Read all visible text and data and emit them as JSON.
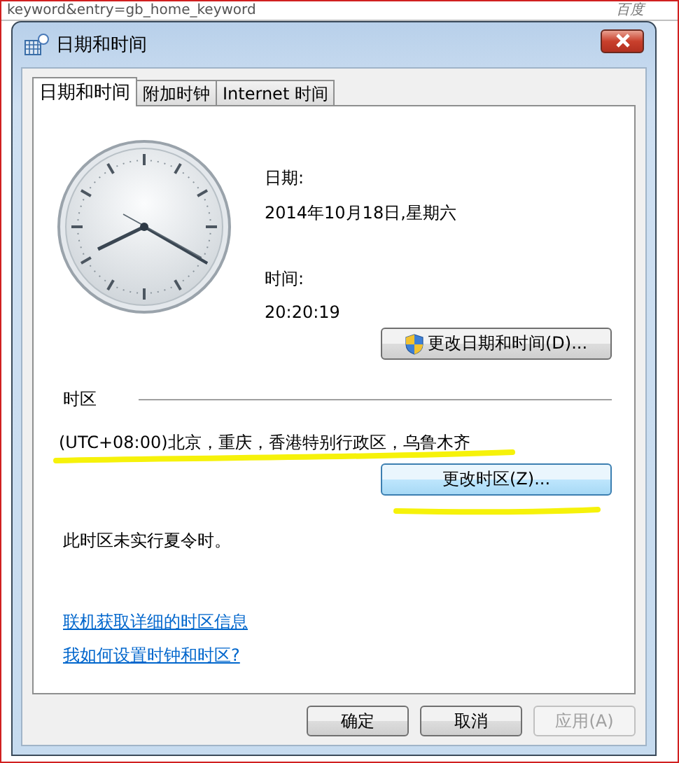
{
  "browser": {
    "address_text": "keyword&entry=gb_home_keyword",
    "search_label": "百度"
  },
  "window": {
    "title": "日期和时间"
  },
  "tabs": [
    {
      "label": "日期和时间",
      "selected": true
    },
    {
      "label": "附加时钟",
      "selected": false
    },
    {
      "label": "Internet 时间",
      "selected": false
    }
  ],
  "date": {
    "label": "日期:",
    "value": "2014年10月18日,星期六"
  },
  "time": {
    "label": "时间:",
    "value": "20:20:19"
  },
  "change_datetime_button": {
    "label": "更改日期和时间(D)...",
    "shield": true
  },
  "timezone": {
    "heading": "时区",
    "value": "(UTC+08:00)北京，重庆，香港特别行政区，乌鲁木齐",
    "button": "更改时区(Z)...",
    "dst_note": "此时区未实行夏令时。"
  },
  "links": [
    "联机获取详细的时区信息",
    "我如何设置时钟和时区?"
  ],
  "buttons": [
    {
      "label": "确定",
      "disabled": false
    },
    {
      "label": "取消",
      "disabled": false
    },
    {
      "label": "应用(A)",
      "disabled": true
    }
  ]
}
